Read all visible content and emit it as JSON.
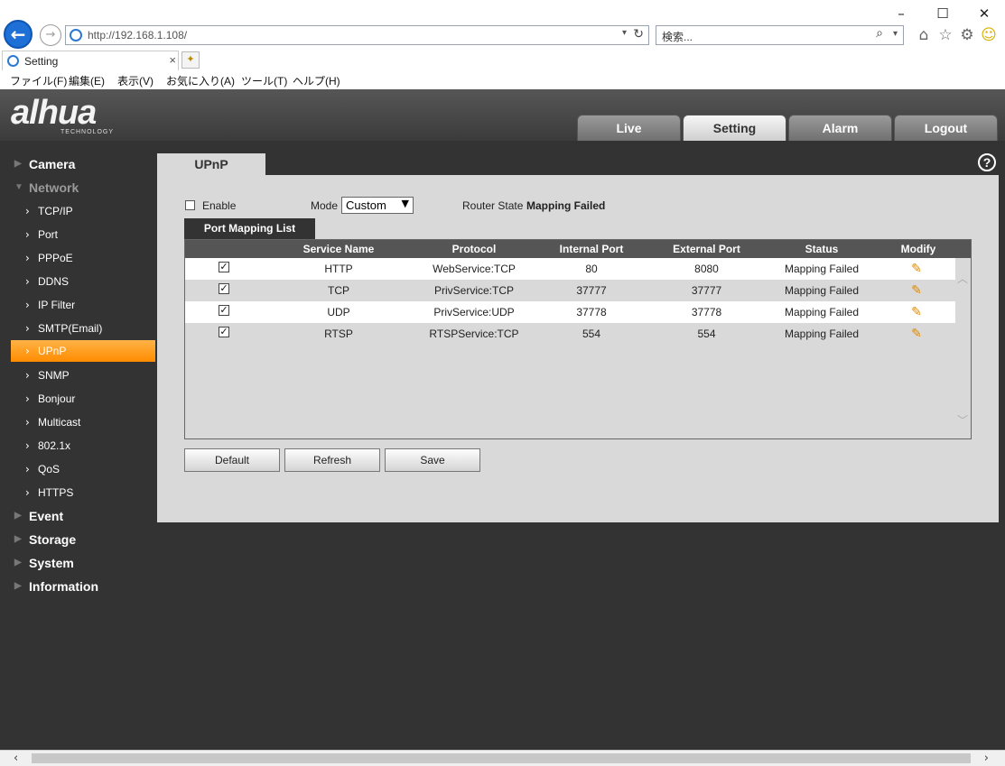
{
  "browser": {
    "url": "http://192.168.1.108/",
    "search_placeholder": "検索...",
    "tab_title": "Setting",
    "menu": [
      "ファイル(F)",
      "編集(E)",
      "表示(V)",
      "お気に入り(A)",
      "ツール(T)",
      "ヘルプ(H)"
    ]
  },
  "header": {
    "logo": "alhua",
    "logo_sub": "TECHNOLOGY",
    "tabs": [
      "Live",
      "Setting",
      "Alarm",
      "Logout"
    ],
    "active_tab": "Setting"
  },
  "sidebar": {
    "categories": {
      "camera": "Camera",
      "network": "Network",
      "event": "Event",
      "storage": "Storage",
      "system": "System",
      "information": "Information"
    },
    "network_items": [
      "TCP/IP",
      "Port",
      "PPPoE",
      "DDNS",
      "IP Filter",
      "SMTP(Email)",
      "UPnP",
      "SNMP",
      "Bonjour",
      "Multicast",
      "802.1x",
      "QoS",
      "HTTPS"
    ],
    "active_item": "UPnP"
  },
  "page": {
    "tab_title": "UPnP",
    "help": "?",
    "enable_label": "Enable",
    "enable_checked": false,
    "mode_label": "Mode",
    "mode_value": "Custom",
    "router_state_label": "Router State",
    "router_state_value": "Mapping Failed",
    "list_tab": "Port Mapping List",
    "columns": [
      "Service Name",
      "Protocol",
      "Internal Port",
      "External Port",
      "Status",
      "Modify"
    ],
    "rows": [
      {
        "checked": true,
        "service": "HTTP",
        "protocol": "WebService:TCP",
        "internal": "80",
        "external": "8080",
        "status": "Mapping Failed"
      },
      {
        "checked": true,
        "service": "TCP",
        "protocol": "PrivService:TCP",
        "internal": "37777",
        "external": "37777",
        "status": "Mapping Failed"
      },
      {
        "checked": true,
        "service": "UDP",
        "protocol": "PrivService:UDP",
        "internal": "37778",
        "external": "37778",
        "status": "Mapping Failed"
      },
      {
        "checked": true,
        "service": "RTSP",
        "protocol": "RTSPService:TCP",
        "internal": "554",
        "external": "554",
        "status": "Mapping Failed"
      }
    ],
    "buttons": {
      "default": "Default",
      "refresh": "Refresh",
      "save": "Save"
    }
  },
  "colors": {
    "active_orange": "#ff8c00",
    "sidebar_bg": "#333333",
    "panel_bg": "#d9d9d9"
  }
}
